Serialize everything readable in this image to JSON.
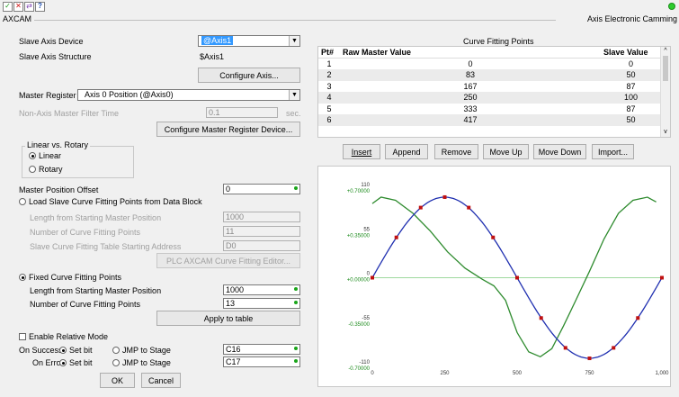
{
  "toolbar": {
    "icons": [
      "check-icon",
      "close-icon",
      "swap-icon",
      "help-icon"
    ]
  },
  "window": {
    "title": "AXCAM",
    "subtitle": "Axis Electronic Camming"
  },
  "slave_axis_device": {
    "label": "Slave Axis Device",
    "value": "@Axis1"
  },
  "slave_axis_structure": {
    "label": "Slave Axis Structure",
    "value": "$Axis1"
  },
  "configure_axis": {
    "label": "Configure Axis..."
  },
  "master_register": {
    "label": "Master Register",
    "value": "Axis 0 Position (@Axis0)"
  },
  "non_axis_filter": {
    "label": "Non-Axis Master Filter Time",
    "value": "0.1",
    "unit": "sec."
  },
  "configure_master": {
    "label": "Configure Master Register Device..."
  },
  "linear_rotary": {
    "title": "Linear vs. Rotary",
    "linear": "Linear",
    "rotary": "Rotary",
    "selected": "Linear"
  },
  "master_offset": {
    "label": "Master Position Offset",
    "value": "0"
  },
  "load_block": {
    "label": "Load Slave Curve Fitting Points from Data Block",
    "selected": false
  },
  "length_start_dis": {
    "label": "Length from Starting Master Position",
    "value": "1000"
  },
  "num_points_dis": {
    "label": "Number of Curve Fitting Points",
    "value": "11"
  },
  "slave_table_addr": {
    "label": "Slave Curve Fitting Table Starting Address",
    "value": "D0"
  },
  "plc_editor": {
    "label": "PLC AXCAM Curve Fitting Editor..."
  },
  "fixed_points": {
    "label": "Fixed Curve Fitting Points",
    "selected": true
  },
  "length_start": {
    "label": "Length from Starting Master Position",
    "value": "1000"
  },
  "num_points": {
    "label": "Number of Curve Fitting Points",
    "value": "13"
  },
  "apply_table": {
    "label": "Apply to table"
  },
  "relative_mode": {
    "label": "Enable Relative Mode",
    "checked": false
  },
  "on_success": {
    "label": "On Success:",
    "setbit": "Set bit",
    "jmp": "JMP to Stage",
    "value": "C16"
  },
  "on_error": {
    "label": "On Error:",
    "setbit": "Set bit",
    "jmp": "JMP to Stage",
    "value": "C17"
  },
  "dialog": {
    "ok": "OK",
    "cancel": "Cancel"
  },
  "cft": {
    "title": "Curve Fitting Points",
    "headers": [
      "Pt#",
      "Raw Master Value",
      "Slave Value"
    ],
    "rows": [
      [
        "1",
        "0",
        "0"
      ],
      [
        "2",
        "83",
        "50"
      ],
      [
        "3",
        "167",
        "87"
      ],
      [
        "4",
        "250",
        "100"
      ],
      [
        "5",
        "333",
        "87"
      ],
      [
        "6",
        "417",
        "50"
      ]
    ]
  },
  "table_buttons": {
    "insert": "Insert",
    "append": "Append",
    "remove": "Remove",
    "move_up": "Move Up",
    "move_down": "Move Down",
    "import": "Import..."
  },
  "colors": {
    "blue_curve": "#1f2fb0",
    "green_curve": "#2e8b2e",
    "points": "#c01010",
    "zero_line": "#9fd89f"
  },
  "chart_data": {
    "type": "line",
    "y_ticks_left": [
      "110",
      "55",
      "0",
      "-55",
      "-110"
    ],
    "y_ticks_right": [
      "+0.70000",
      "+0.35000",
      "+0.00000",
      "-0.35000",
      "-0.70000"
    ],
    "x_ticks": [
      "0",
      "250",
      "500",
      "750",
      "1,000"
    ],
    "xlim": [
      0,
      1000
    ],
    "ylim": [
      -110,
      110
    ],
    "series": [
      {
        "color": "blue",
        "x": [
          0,
          83,
          167,
          250,
          333,
          417,
          500,
          583,
          667,
          750,
          833,
          917,
          1000
        ],
        "y": [
          0,
          50,
          87,
          100,
          87,
          50,
          0,
          -50,
          -87,
          -100,
          -87,
          -50,
          0
        ]
      },
      {
        "color": "green",
        "x": [
          0,
          30,
          80,
          140,
          200,
          260,
          320,
          380,
          420,
          460,
          500,
          540,
          580,
          620,
          660,
          700,
          750,
          800,
          850,
          900,
          950,
          980
        ],
        "y": [
          92,
          100,
          96,
          80,
          58,
          32,
          12,
          -2,
          -10,
          -28,
          -68,
          -92,
          -98,
          -88,
          -60,
          -30,
          8,
          48,
          80,
          96,
          100,
          94
        ]
      }
    ],
    "grid": false
  }
}
